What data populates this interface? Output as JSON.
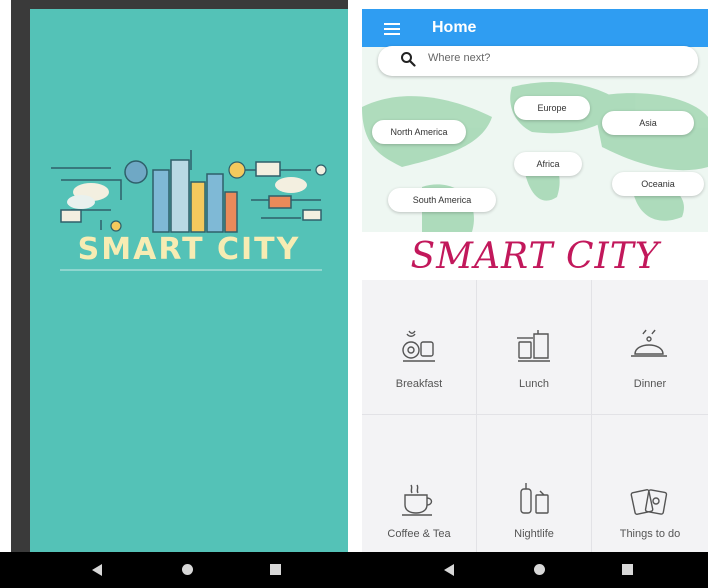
{
  "splash": {
    "title": "SMART CITY",
    "background_color": "#54c2b7",
    "title_color": "#f7ecb3"
  },
  "app": {
    "appbar_title": "Home",
    "appbar_color": "#2f9df2",
    "search": {
      "placeholder": "Where next?"
    },
    "regions": [
      "North America",
      "Europe",
      "Asia",
      "Africa",
      "Oceania",
      "South America"
    ],
    "headline": "SMART CITY",
    "headline_color": "#c2185b",
    "categories": [
      {
        "label": "Breakfast",
        "icon": "breakfast-icon"
      },
      {
        "label": "Lunch",
        "icon": "lunch-icon"
      },
      {
        "label": "Dinner",
        "icon": "dinner-icon"
      },
      {
        "label": "Coffee & Tea",
        "icon": "coffee-tea-icon"
      },
      {
        "label": "Nightlife",
        "icon": "nightlife-icon"
      },
      {
        "label": "Things to do",
        "icon": "things-to-do-icon"
      }
    ]
  },
  "navigation": {
    "buttons": [
      "back-icon",
      "home-icon",
      "recent-apps-icon"
    ]
  }
}
